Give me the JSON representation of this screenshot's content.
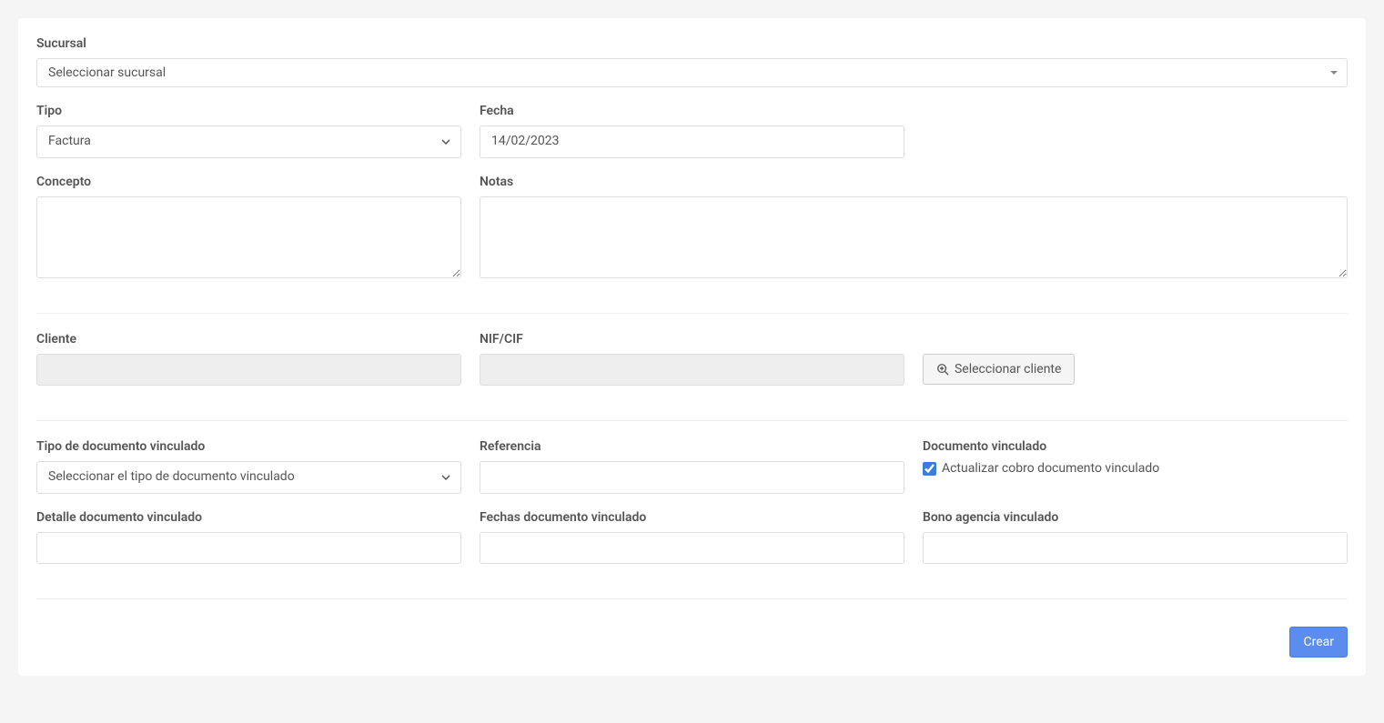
{
  "labels": {
    "sucursal": "Sucursal",
    "tipo": "Tipo",
    "fecha": "Fecha",
    "concepto": "Concepto",
    "notas": "Notas",
    "cliente": "Cliente",
    "nif_cif": "NIF/CIF",
    "tipo_documento_vinculado": "Tipo de documento vinculado",
    "referencia": "Referencia",
    "documento_vinculado": "Documento vinculado",
    "detalle_documento_vinculado": "Detalle documento vinculado",
    "fechas_documento_vinculado": "Fechas documento vinculado",
    "bono_agencia_vinculado": "Bono agencia vinculado"
  },
  "sucursal": {
    "selected": "Seleccionar sucursal"
  },
  "tipo": {
    "selected": "Factura"
  },
  "fecha": {
    "value": "14/02/2023"
  },
  "concepto": {
    "value": ""
  },
  "notas": {
    "value": ""
  },
  "cliente": {
    "value": ""
  },
  "nif_cif": {
    "value": ""
  },
  "select_client_button": "Seleccionar cliente",
  "tipo_documento_vinculado": {
    "selected": "Seleccionar el tipo de documento vinculado"
  },
  "referencia": {
    "value": ""
  },
  "checkbox_label": "Actualizar cobro documento vinculado",
  "checkbox_checked": true,
  "detalle_documento_vinculado": {
    "value": ""
  },
  "fechas_documento_vinculado": {
    "value": ""
  },
  "bono_agencia_vinculado": {
    "value": ""
  },
  "submit_button": "Crear"
}
